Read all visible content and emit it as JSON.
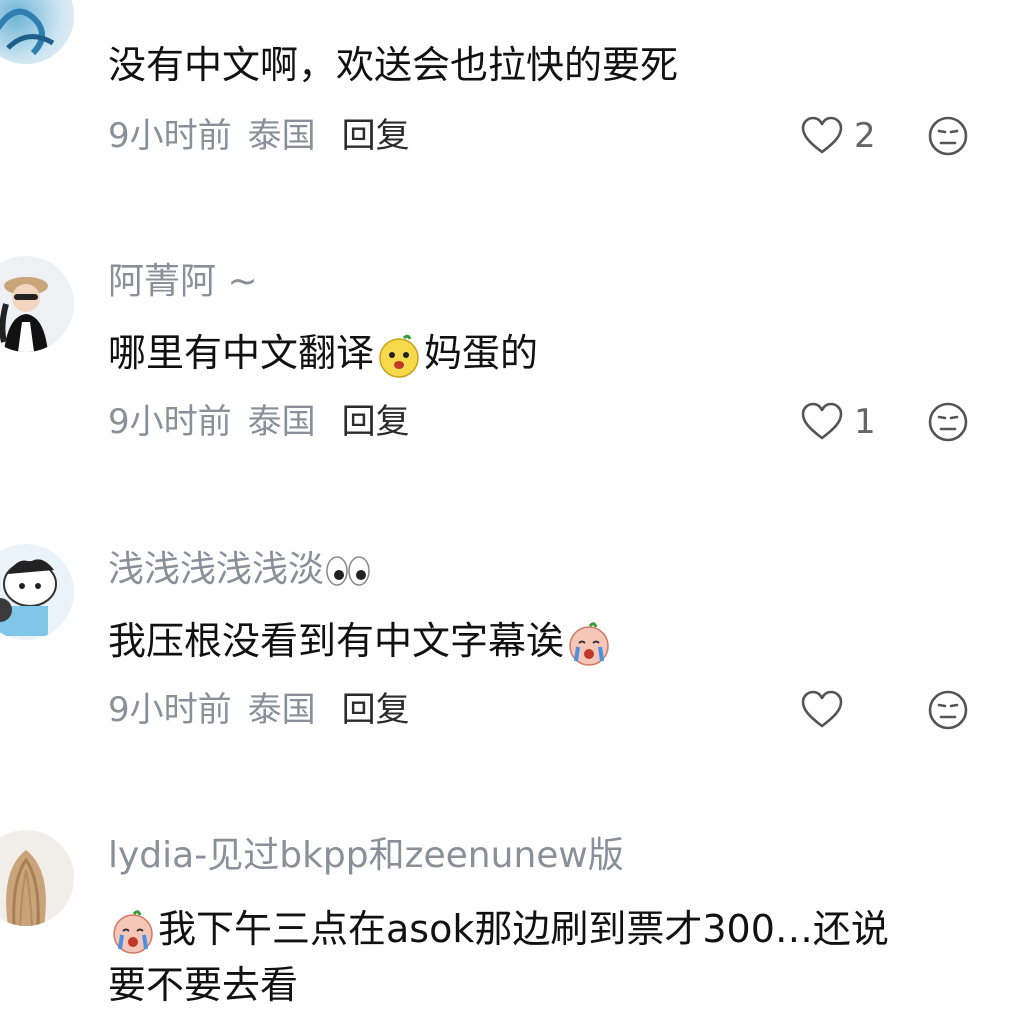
{
  "comments": [
    {
      "username": "",
      "content": "没有中文啊，欢送会也拉快的要死",
      "time": "9小时前",
      "location": "泰国",
      "reply_label": "回复",
      "likes": "2"
    },
    {
      "username": "阿菁阿 ~",
      "content_before": "哪里有中文翻译",
      "content_after": "妈蛋的",
      "time": "9小时前",
      "location": "泰国",
      "reply_label": "回复",
      "likes": "1"
    },
    {
      "username": "浅浅浅浅浅淡",
      "content": "我压根没看到有中文字幕诶",
      "time": "9小时前",
      "location": "泰国",
      "reply_label": "回复",
      "likes": ""
    },
    {
      "username": "lydia-见过bkpp和zeenunew版",
      "content_line1": "我下午三点在asok那边刷到票才300…还说",
      "content_line2": "要不要去看"
    }
  ],
  "icons": {
    "like": "heart-outline-icon",
    "dislike": "meh-face-icon"
  },
  "colors": {
    "text": "#111111",
    "muted": "#8a8f99",
    "reply": "#2b2b2b"
  }
}
